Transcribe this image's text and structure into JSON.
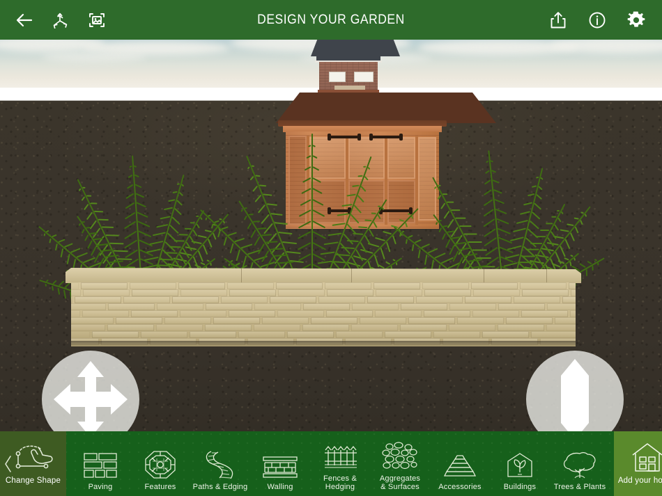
{
  "app": {
    "title": "DESIGN YOUR GARDEN",
    "brand_green": "#2e6b2b",
    "toolbar_green": "#16601b",
    "change_shape_green": "#3e5b22",
    "add_house_green": "#5a8a2c"
  },
  "topbar": {
    "left_icons": [
      {
        "name": "back-arrow-icon",
        "label": "Back"
      },
      {
        "name": "orbit-axis-icon",
        "label": "3D View"
      },
      {
        "name": "photo-frame-icon",
        "label": "Photo"
      }
    ],
    "right_icons": [
      {
        "name": "share-icon",
        "label": "Share"
      },
      {
        "name": "info-icon",
        "label": "Info"
      },
      {
        "name": "gear-icon",
        "label": "Settings"
      }
    ]
  },
  "viewport": {
    "scene_name": "garden-3d-scene",
    "sky_top_color": "#b9cfd3",
    "sky_bottom_color": "#f3efe6",
    "ground_color": "#3a342b",
    "objects": [
      {
        "name": "house",
        "label": "House"
      },
      {
        "name": "summerhouse",
        "label": "Summerhouse"
      },
      {
        "name": "retaining-wall",
        "label": "Walling"
      },
      {
        "name": "fern-plant",
        "label": "Fern"
      }
    ]
  },
  "controls": {
    "pan": {
      "name": "pan-control",
      "label": "Pan"
    },
    "height": {
      "name": "height-control",
      "label": "Height"
    }
  },
  "toolbar": {
    "change_shape": {
      "label": "Change Shape",
      "icon": "hand-drag-shape-icon"
    },
    "add_house": {
      "label": "Add your house",
      "icon": "house-outline-icon"
    },
    "categories": [
      {
        "label": "Paving",
        "icon": "paving-bricks-icon"
      },
      {
        "label": "Features",
        "icon": "octagon-feature-icon"
      },
      {
        "label": "Paths & Edging",
        "icon": "winding-path-icon"
      },
      {
        "label": "Walling",
        "icon": "brick-wall-icon"
      },
      {
        "label": "Fences & Hedging",
        "icon": "fence-picket-icon"
      },
      {
        "label": "Aggregates\n& Surfaces",
        "icon": "gravel-aggregate-icon"
      },
      {
        "label": "Accessories",
        "icon": "tiered-steps-icon"
      },
      {
        "label": "Buildings",
        "icon": "greenhouse-plant-icon"
      },
      {
        "label": "Trees & Plants",
        "icon": "tree-icon"
      }
    ]
  }
}
